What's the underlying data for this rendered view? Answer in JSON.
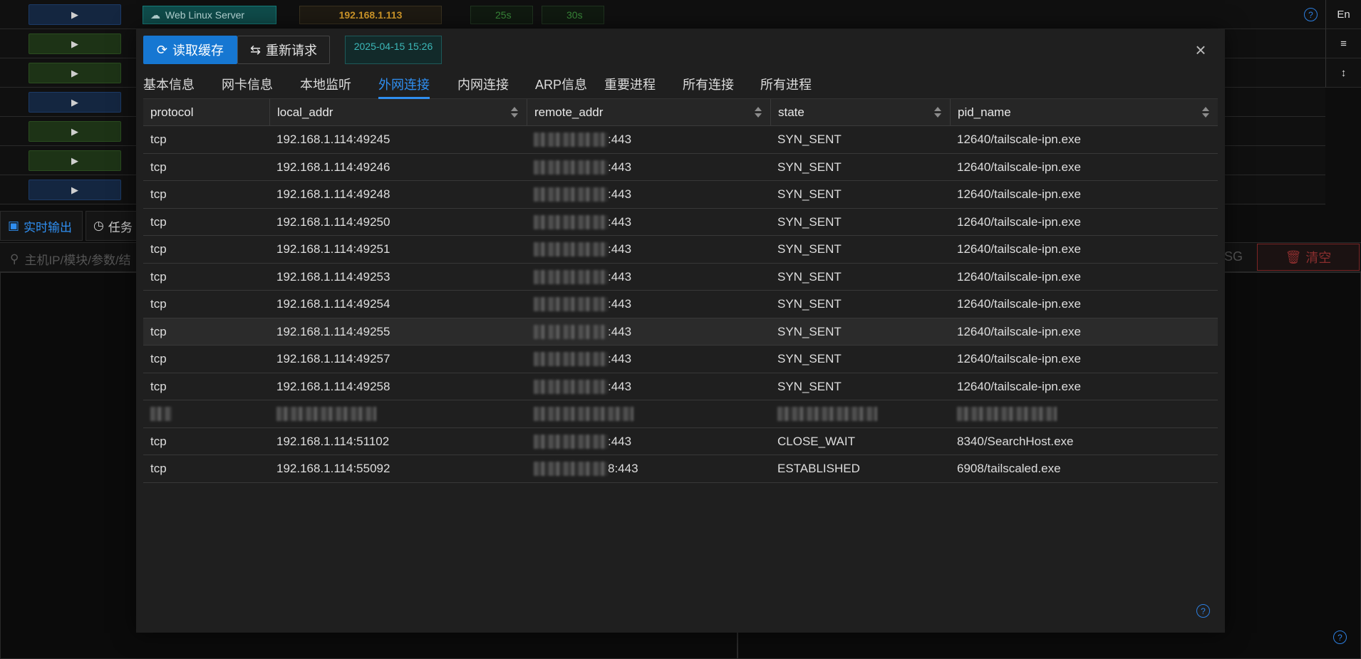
{
  "top_bar": {
    "server_label": "Web Linux Server",
    "ip": "192.168.1.113",
    "timer1": "25s",
    "timer2": "30s",
    "lang_button": "En"
  },
  "bottom": {
    "tab1": "实时输出",
    "tab2": "任务",
    "search_placeholder": "主机IP/模块/参数/结",
    "sg_partial": "SG",
    "clear_label": "清空"
  },
  "modal": {
    "read_cache": "读取缓存",
    "re_request": "重新请求",
    "timestamp": "2025-04-15 15:26",
    "tabs": [
      "基本信息",
      "网卡信息",
      "本地监听",
      "外网连接",
      "内网连接",
      "ARP信息",
      "重要进程",
      "所有连接",
      "所有进程"
    ],
    "active_tab": "外网连接",
    "columns": [
      "protocol",
      "local_addr",
      "remote_addr",
      "state",
      "pid_name"
    ],
    "rows": [
      {
        "protocol": "tcp",
        "local_addr": "192.168.1.114:49245",
        "remote_port": ":443",
        "state": "SYN_SENT",
        "pid_name": "12640/tailscale-ipn.exe"
      },
      {
        "protocol": "tcp",
        "local_addr": "192.168.1.114:49246",
        "remote_port": ":443",
        "state": "SYN_SENT",
        "pid_name": "12640/tailscale-ipn.exe"
      },
      {
        "protocol": "tcp",
        "local_addr": "192.168.1.114:49248",
        "remote_port": ":443",
        "state": "SYN_SENT",
        "pid_name": "12640/tailscale-ipn.exe"
      },
      {
        "protocol": "tcp",
        "local_addr": "192.168.1.114:49250",
        "remote_port": ":443",
        "state": "SYN_SENT",
        "pid_name": "12640/tailscale-ipn.exe"
      },
      {
        "protocol": "tcp",
        "local_addr": "192.168.1.114:49251",
        "remote_port": ":443",
        "state": "SYN_SENT",
        "pid_name": "12640/tailscale-ipn.exe"
      },
      {
        "protocol": "tcp",
        "local_addr": "192.168.1.114:49253",
        "remote_port": ":443",
        "state": "SYN_SENT",
        "pid_name": "12640/tailscale-ipn.exe"
      },
      {
        "protocol": "tcp",
        "local_addr": "192.168.1.114:49254",
        "remote_port": ":443",
        "state": "SYN_SENT",
        "pid_name": "12640/tailscale-ipn.exe"
      },
      {
        "protocol": "tcp",
        "local_addr": "192.168.1.114:49255",
        "remote_port": ":443",
        "state": "SYN_SENT",
        "pid_name": "12640/tailscale-ipn.exe"
      },
      {
        "protocol": "tcp",
        "local_addr": "192.168.1.114:49257",
        "remote_port": ":443",
        "state": "SYN_SENT",
        "pid_name": "12640/tailscale-ipn.exe"
      },
      {
        "protocol": "tcp",
        "local_addr": "192.168.1.114:49258",
        "remote_port": ":443",
        "state": "SYN_SENT",
        "pid_name": "12640/tailscale-ipn.exe"
      },
      {
        "protocol": "",
        "local_addr": "",
        "remote_port": "",
        "state": "",
        "pid_name": ""
      },
      {
        "protocol": "tcp",
        "local_addr": "192.168.1.114:51102",
        "remote_port": ":443",
        "state": "CLOSE_WAIT",
        "pid_name": "8340/SearchHost.exe"
      },
      {
        "protocol": "tcp",
        "local_addr": "192.168.1.114:55092",
        "remote_port": "8:443",
        "state": "ESTABLISHED",
        "pid_name": "6908/tailscaled.exe"
      }
    ]
  }
}
